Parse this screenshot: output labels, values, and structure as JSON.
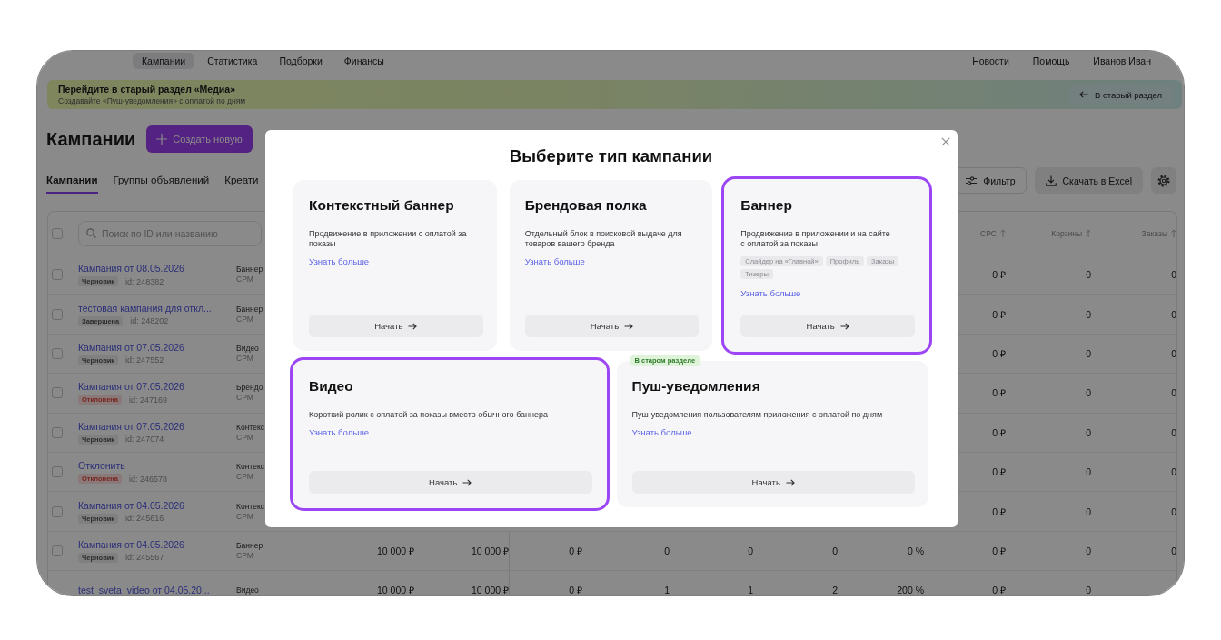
{
  "nav": {
    "left_items": [
      {
        "label": "Кампании",
        "selected": true
      },
      {
        "label": "Статистика",
        "selected": false
      },
      {
        "label": "Подборки",
        "selected": false
      },
      {
        "label": "Финансы",
        "selected": false
      }
    ],
    "right_items": [
      "Новости",
      "Помощь",
      "Иванов Иван"
    ]
  },
  "notice_banner": {
    "title": "Перейдите в старый раздел «Медиа»",
    "subtitle": "Создавайте «Пуш-уведомления» с оплатой по дням",
    "button": "В старый раздел"
  },
  "page_header": {
    "title": "Кампании",
    "create_button": "Создать новую"
  },
  "tabs": [
    {
      "label": "Кампании",
      "selected": true
    },
    {
      "label": "Группы объявлений",
      "selected": false
    },
    {
      "label": "Креати",
      "selected": false
    }
  ],
  "toolbar": {
    "filter_button": "Фильтр",
    "export_button": "Скачать в Excel"
  },
  "table": {
    "select_all_checked": false,
    "search": {
      "placeholder": "Поиск по ID или названию"
    },
    "columns": [
      "CPC",
      "Корзины",
      "Заказы"
    ],
    "rows": [
      {
        "checked": false,
        "name": "Кампания от 08.05.2026",
        "status": {
          "label": "Черновик",
          "kind": "neutral"
        },
        "id": "id: 248382",
        "type": "Баннер",
        "pricing": "CPM",
        "right_cells": [
          "0 ₽",
          "0",
          "0"
        ]
      },
      {
        "checked": false,
        "name": "тестовая кампания для откл...",
        "status": {
          "label": "Завершена",
          "kind": "neutral"
        },
        "id": "id: 248202",
        "type": "Баннер",
        "pricing": "CPM",
        "right_cells": [
          "0 ₽",
          "0",
          "0"
        ]
      },
      {
        "checked": false,
        "name": "Кампания от 07.05.2026",
        "status": {
          "label": "Черновик",
          "kind": "neutral"
        },
        "id": "id: 247552",
        "type": "Видео",
        "pricing": "CPM",
        "right_cells": [
          "0 ₽",
          "0",
          "0"
        ]
      },
      {
        "checked": false,
        "name": "Кампания от 07.05.2026",
        "status": {
          "label": "Отклонена",
          "kind": "rejected"
        },
        "id": "id: 247169",
        "type": "Брендо",
        "pricing": "CPM",
        "right_cells": [
          "0 ₽",
          "0",
          "0"
        ]
      },
      {
        "checked": false,
        "name": "Кампания от 07.05.2026",
        "status": {
          "label": "Черновик",
          "kind": "neutral"
        },
        "id": "id: 247074",
        "type": "Контекс",
        "pricing": "CPM",
        "right_cells": [
          "0 ₽",
          "0",
          "0"
        ]
      },
      {
        "checked": false,
        "name": "Отклонить",
        "status": {
          "label": "Отклонена",
          "kind": "rejected"
        },
        "id": "id: 246578",
        "type": "Контекс",
        "pricing": "CPM",
        "right_cells": [
          "0 ₽",
          "0",
          "0"
        ]
      },
      {
        "checked": false,
        "name": "Кампания от 04.05.2026",
        "status": {
          "label": "Черновик",
          "kind": "neutral"
        },
        "id": "id: 245616",
        "type": "Контекс",
        "pricing": "CPM",
        "right_cells": [
          "0 ₽",
          "0",
          "0"
        ]
      },
      {
        "checked": false,
        "name": "Кампания от 04.05.2026",
        "status": {
          "label": "Черновик",
          "kind": "neutral"
        },
        "id": "id: 245567",
        "type": "Баннер",
        "pricing": "CPM",
        "middle_cells": [
          "10 000 ₽",
          "10 000 ₽",
          "0 ₽",
          "0",
          "0",
          "0",
          "0 %"
        ],
        "right_cells": [
          "0 ₽",
          "0",
          "0"
        ]
      },
      {
        "name": "test_sveta_video от 04.05.20...",
        "type": "Видео",
        "middle_cells": [
          "10 000 ₽",
          "10 000 ₽",
          "0 ₽",
          "1",
          "1",
          "2",
          "200 %"
        ],
        "right_cells": [
          "0 ₽",
          "0"
        ]
      }
    ]
  },
  "modal": {
    "title": "Выберите тип кампании",
    "card_rows": [
      [
        {
          "title": "Контекстный баннер",
          "description": "Продвижение в приложении с оплатой за показы",
          "link": "Узнать больше",
          "button": "Начать",
          "selected": false
        },
        {
          "title": "Брендовая полка",
          "description": "Отдельный блок в поисковой выдаче для товаров вашего бренда",
          "link": "Узнать больше",
          "button": "Начать",
          "selected": false
        },
        {
          "title": "Баннер",
          "description": "Продвижение в приложении и на сайте с оплатой за показы",
          "tags": [
            "Слайдер на «Главной»",
            "Профиль",
            "Заказы",
            "Тизеры"
          ],
          "link": "Узнать больше",
          "button": "Начать",
          "selected": true
        }
      ],
      [
        {
          "title": "Видео",
          "description": "Короткий ролик с оплатой за показы вместо обычного баннера",
          "link": "Узнать больше",
          "button": "Начать",
          "selected": true
        },
        {
          "badge": "В старом разделе",
          "title": "Пуш-уведомления",
          "description": "Пуш-уведомления пользователям приложения с оплатой по дням",
          "link": "Узнать больше",
          "button": "Начать",
          "selected": false
        }
      ]
    ]
  }
}
